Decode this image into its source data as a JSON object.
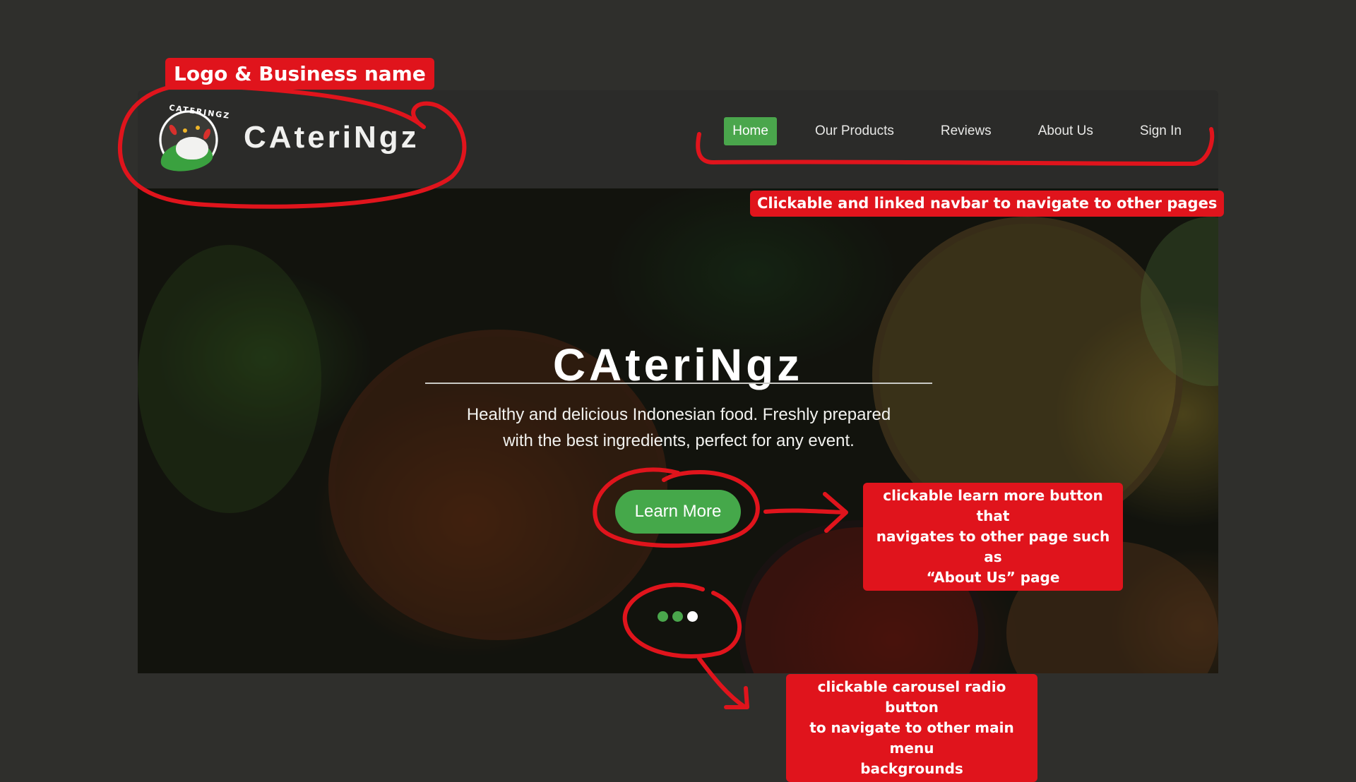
{
  "site": {
    "brand_name": "CAteriNgz",
    "logo_ring_text": "CATERINGZ",
    "nav": [
      {
        "label": "Home",
        "active": true
      },
      {
        "label": "Our Products",
        "active": false
      },
      {
        "label": "Reviews",
        "active": false
      },
      {
        "label": "About Us",
        "active": false
      },
      {
        "label": "Sign In",
        "active": false
      }
    ],
    "hero": {
      "title": "CAteriNgz",
      "subtitle_line1": "Healthy and delicious Indonesian food. Freshly prepared",
      "subtitle_line2": "with the best ingredients, perfect for any event.",
      "cta_label": "Learn More",
      "carousel": {
        "count": 3,
        "current_index": 3
      }
    }
  },
  "annotations": {
    "logo": "Logo & Business name",
    "navbar": "Clickable and linked navbar to navigate to other pages",
    "learn_more": [
      "clickable learn more button that",
      "navigates to other page such as",
      "“About Us” page"
    ],
    "carousel": [
      "clickable carousel radio button",
      "to navigate to other main menu",
      "backgrounds"
    ]
  },
  "colors": {
    "page_background": "#2f2f2c",
    "navbar_background": "#2b2b29",
    "accent_green": "#4aa64c",
    "annotation_red": "#e0141c"
  },
  "icons": {
    "logo": "catering-rice-leaf-logo"
  }
}
